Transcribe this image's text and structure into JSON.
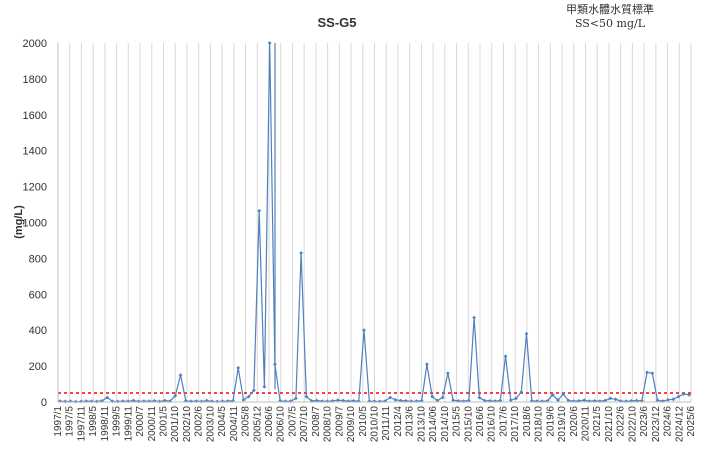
{
  "chart_data": {
    "type": "line",
    "title": "SS-G5",
    "ylabel": "(mg/L)",
    "xlabel": "",
    "standard_note_line1": "甲類水體水質標準",
    "standard_note_line2": "SS<50 mg/L",
    "ylim": [
      0,
      2000
    ],
    "y_ticks": [
      0,
      200,
      400,
      600,
      800,
      1000,
      1200,
      1400,
      1600,
      1800,
      2000
    ],
    "x_tick_labels": [
      "1997/1",
      "1997/5",
      "1997/11",
      "1998/5",
      "1998/11",
      "1999/5",
      "1999/11",
      "2000/7",
      "2000/11",
      "2001/5",
      "2001/10",
      "2002/10",
      "2002/6",
      "2003/10",
      "2004/5",
      "2004/11",
      "2005/8",
      "2005/12",
      "2006/6",
      "2006/10",
      "2007/5",
      "2007/10",
      "2008/7",
      "2008/10",
      "2009/7",
      "2009/10",
      "2010/5",
      "2010/10",
      "2011/11",
      "2012/4",
      "2013/6",
      "2013/10",
      "2014/06",
      "2014/10",
      "2015/5",
      "2015/10",
      "2016/6",
      "2016/10",
      "2017/6",
      "2017/10",
      "2018/6",
      "2018/10",
      "2019/6",
      "2019/10",
      "2020/6",
      "2020/11",
      "2021/5",
      "2021/10",
      "2022/6",
      "2022/10",
      "2023/6",
      "2023/12",
      "2024/6",
      "2024/12",
      "2025/6"
    ],
    "grid": "vertical",
    "series": [
      {
        "name": "",
        "color": "#4f81bd",
        "marker": "diamond",
        "values": [
          5,
          3,
          4,
          2,
          3,
          5,
          4,
          3,
          6,
          25,
          4,
          3,
          5,
          4,
          8,
          3,
          5,
          4,
          6,
          3,
          8,
          5,
          35,
          150,
          6,
          4,
          5,
          3,
          8,
          4,
          3,
          4,
          5,
          7,
          190,
          12,
          30,
          65,
          1065,
          85,
          2000,
          210,
          6,
          4,
          5,
          20,
          830,
          30,
          6,
          8,
          5,
          4,
          6,
          10,
          8,
          5,
          6,
          5,
          400,
          5,
          4,
          3,
          5,
          25,
          12,
          8,
          6,
          4,
          5,
          7,
          210,
          30,
          8,
          25,
          160,
          10,
          6,
          5,
          8,
          470,
          25,
          8,
          6,
          5,
          8,
          255,
          10,
          20,
          55,
          380,
          6,
          5,
          4,
          6,
          40,
          10,
          45,
          8,
          5,
          6,
          10,
          5,
          6,
          5,
          8,
          20,
          15,
          5,
          4,
          6,
          8,
          7,
          165,
          160,
          10,
          5,
          12,
          15,
          30,
          45,
          40
        ]
      },
      {
        "name": "",
        "color": "#4f81bd",
        "marker": "none",
        "values": [
          2000,
          70
        ]
      }
    ],
    "reference_line": {
      "value": 50,
      "color": "#ff0000",
      "style": "dashed"
    }
  }
}
